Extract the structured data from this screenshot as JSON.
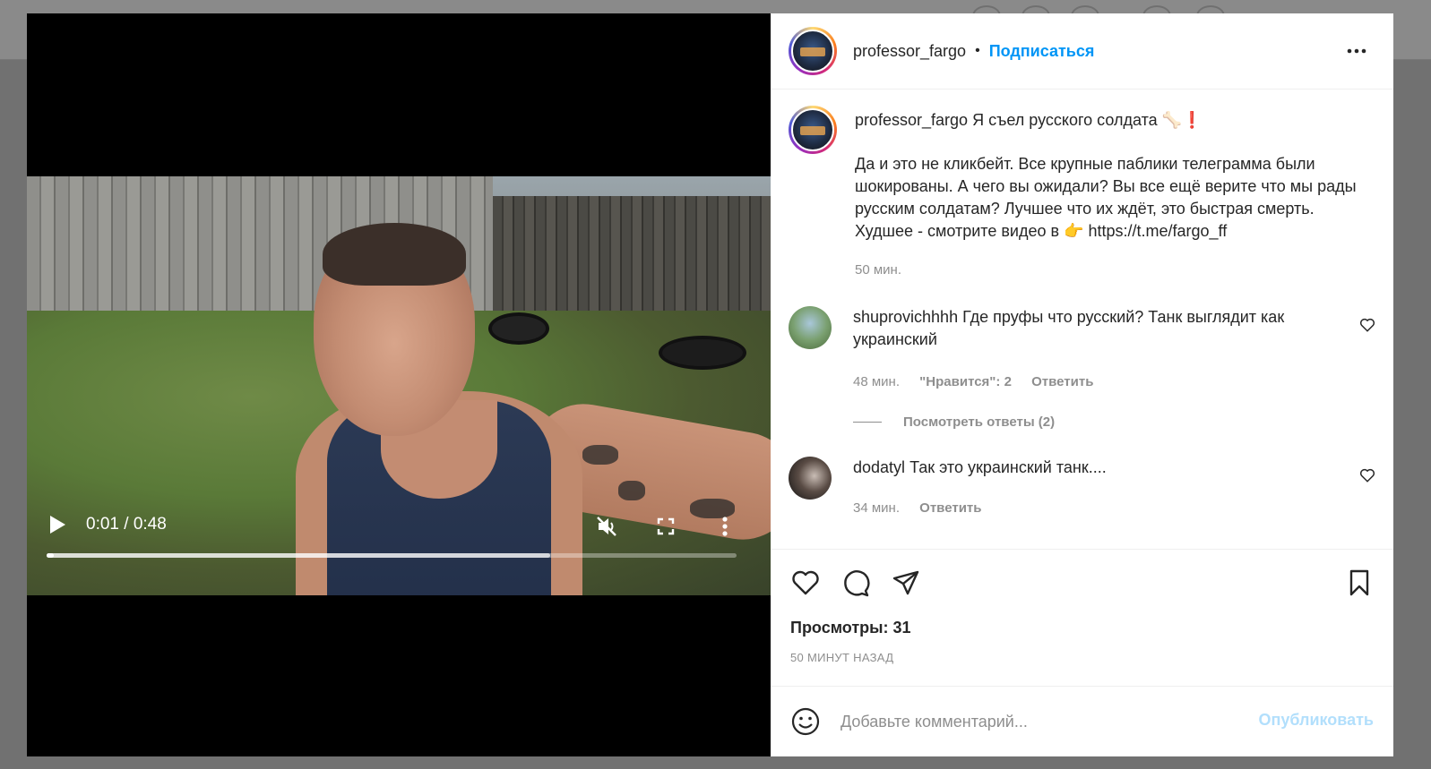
{
  "post": {
    "username": "professor_fargo",
    "separator": "•",
    "follow_label": "Подписаться"
  },
  "video": {
    "time": "0:01 / 0:48",
    "played_fraction": 0.01,
    "buffered_fraction": 0.73
  },
  "caption": {
    "username": "professor_fargo",
    "title": "Я съел русского солдата 🦴❗",
    "body": "Да и это не кликбейт. Все крупные паблики телеграмма были шокированы. А чего вы ожидали? Вы все ещё верите что мы рады русским солдатам? Лучшее что их ждёт, это быстрая смерть. Худшее - смотрите видео в 👉 https://t.me/fargo_ff",
    "time": "50 мин."
  },
  "comments": [
    {
      "username": "shuprovichhhh",
      "text": "Где пруфы что русский? Танк выглядит как украинский",
      "time": "48 мин.",
      "likes": "\"Нравится\": 2",
      "reply": "Ответить",
      "view_replies": "Посмотреть ответы (2)"
    },
    {
      "username": "dodatyl",
      "text": "Так это украинский танк....",
      "time": "34 мин.",
      "reply": "Ответить"
    }
  ],
  "stats": {
    "views": "Просмотры: 31",
    "ago": "50 МИНУТ НАЗАД"
  },
  "composer": {
    "placeholder": "Добавьте комментарий...",
    "publish_label": "Опубликовать"
  },
  "colors": {
    "accent": "#0095f6",
    "publish_disabled": "#b2dffc",
    "muted": "#8e8e8e",
    "text": "#262626"
  }
}
